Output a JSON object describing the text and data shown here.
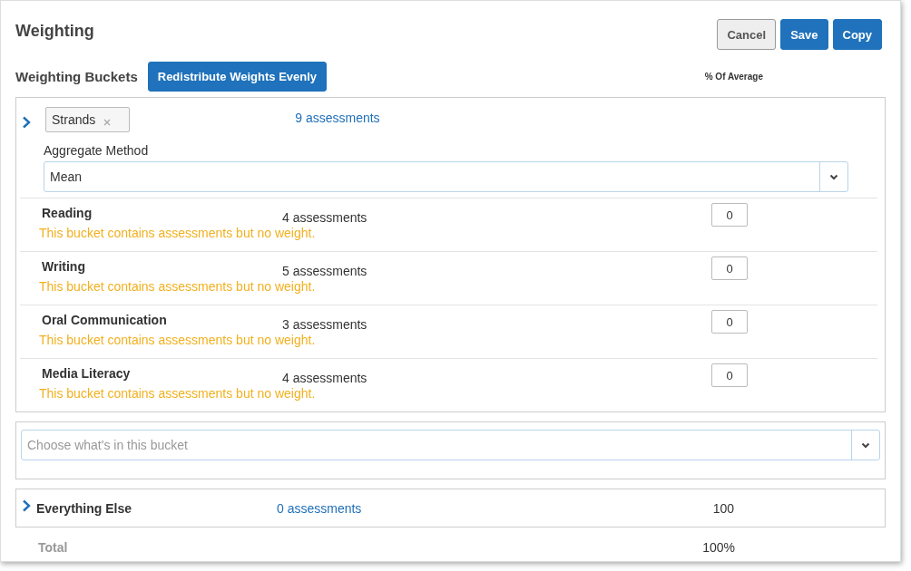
{
  "title": "Weighting",
  "actions": [
    {
      "label": "Cancel",
      "kind": "secondary"
    },
    {
      "label": "Save",
      "kind": "primary"
    },
    {
      "label": "Copy",
      "kind": "primary"
    }
  ],
  "buckets_label": "Weighting Buckets",
  "redistribute_button": "Redistribute Weights Evenly",
  "column_header": "% Of Average",
  "bucket": {
    "tag": "Strands",
    "assessments": "9 assessments",
    "aggregate_label": "Aggregate Method",
    "aggregate_value": "Mean",
    "rows": [
      {
        "name": "Reading",
        "count": "4 assessments",
        "weight": "0",
        "warning": "This bucket contains assessments but no weight."
      },
      {
        "name": "Writing",
        "count": "5 assessments",
        "weight": "0",
        "warning": "This bucket contains assessments but no weight."
      },
      {
        "name": "Oral Communication",
        "count": "3 assessments",
        "weight": "0",
        "warning": "This bucket contains assessments but no weight."
      },
      {
        "name": "Media Literacy",
        "count": "4 assessments",
        "weight": "0",
        "warning": "This bucket contains assessments but no weight."
      }
    ]
  },
  "new_bucket": {
    "placeholder": "Choose what's in this bucket"
  },
  "everything_else": {
    "name": "Everything Else",
    "assessments": "0 assessments",
    "weight": "100"
  },
  "total": {
    "label": "Total",
    "value": "100%"
  }
}
